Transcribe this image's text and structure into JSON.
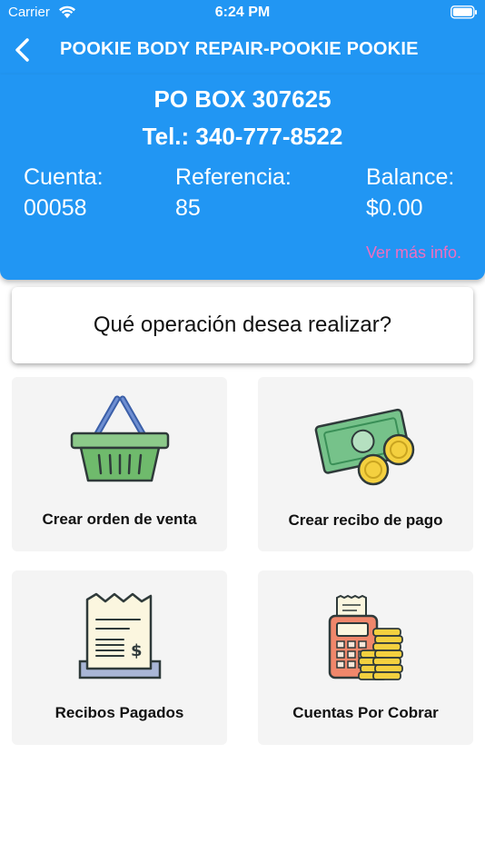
{
  "status_bar": {
    "carrier": "Carrier",
    "time": "6:24 PM"
  },
  "nav": {
    "title": "POOKIE BODY REPAIR-POOKIE POOKIE"
  },
  "account": {
    "address": "PO BOX 307625",
    "phone_label": "Tel.:",
    "phone": "340-777-8522",
    "cuenta_label": "Cuenta:",
    "cuenta": "00058",
    "referencia_label": "Referencia:",
    "referencia": "85",
    "balance_label": "Balance:",
    "balance": "$0.00",
    "more_info": "Ver más info."
  },
  "question": "Qué operación desea realizar?",
  "actions": [
    {
      "label": "Crear orden de venta",
      "icon": "basket-icon"
    },
    {
      "label": "Crear recibo de pago",
      "icon": "money-icon"
    },
    {
      "label": "Recibos Pagados",
      "icon": "receipt-icon"
    },
    {
      "label": "Cuentas Por Cobrar",
      "icon": "register-coins-icon"
    }
  ],
  "colors": {
    "primary": "#2196f3",
    "accent": "#f06ec0",
    "tile_bg": "#f4f4f4"
  }
}
